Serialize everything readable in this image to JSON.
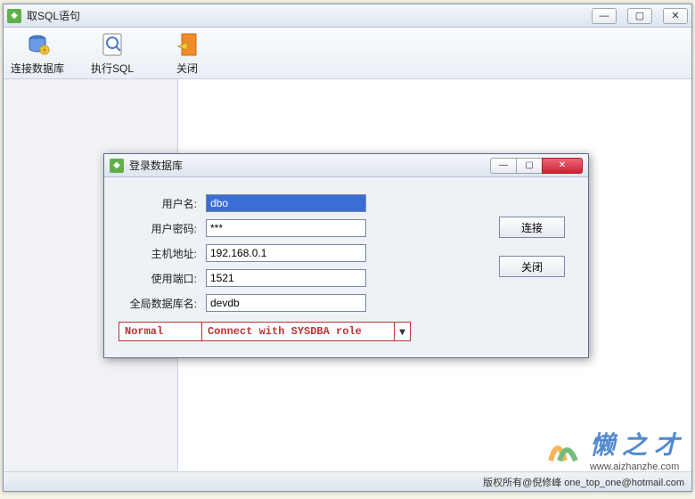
{
  "main": {
    "title": "取SQL语句",
    "toolbar": [
      {
        "label": "连接数据库",
        "icon": "db-connect-icon"
      },
      {
        "label": "执行SQL",
        "icon": "run-sql-icon"
      },
      {
        "label": "关闭",
        "icon": "close-doc-icon"
      }
    ],
    "statusbar": "版权所有@倪修峰 one_top_one@hotmail.com"
  },
  "dialog": {
    "title": "登录数据库",
    "fields": {
      "username_label": "用户名:",
      "username_value": "dbo",
      "password_label": "用户密码:",
      "password_value": "***",
      "host_label": "主机地址:",
      "host_value": "192.168.0.1",
      "port_label": "使用端口:",
      "port_value": "1521",
      "dbname_label": "全局数据库名:",
      "dbname_value": "devdb"
    },
    "role": {
      "mode": "Normal",
      "desc": "Connect with SYSDBA role"
    },
    "buttons": {
      "connect": "连接",
      "close": "关闭"
    }
  },
  "watermark": {
    "title": "懒之才",
    "url": "www.aizhanzhe.com"
  }
}
